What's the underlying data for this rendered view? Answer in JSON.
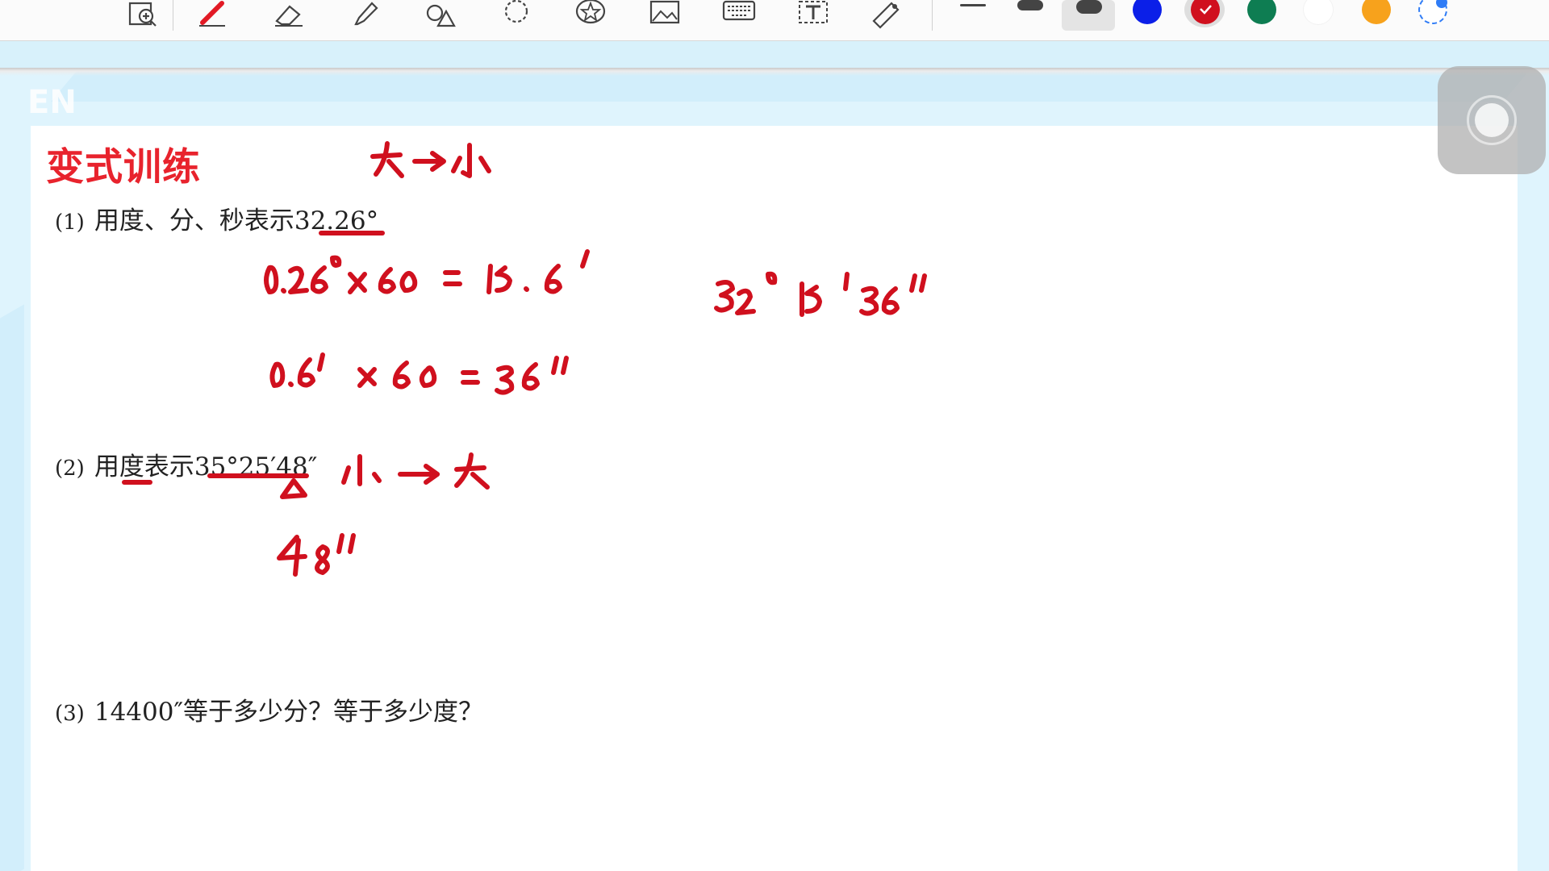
{
  "toolbar": {
    "tools": [
      "zoom-tool",
      "pen-tool",
      "eraser-tool",
      "highlighter-tool",
      "shapes-tool",
      "lasso-tool",
      "sticker-tool",
      "image-tool",
      "keyboard-tool",
      "text-tool",
      "laser-pointer-tool"
    ],
    "line_widths": [
      "thin",
      "medium",
      "thick"
    ],
    "colors": [
      {
        "name": "blue",
        "hex": "#0b1fe8"
      },
      {
        "name": "red",
        "hex": "#d0101e",
        "selected": true
      },
      {
        "name": "green",
        "hex": "#0e7d52"
      },
      {
        "name": "white",
        "hex": "#ffffff"
      },
      {
        "name": "orange",
        "hex": "#f7a21c"
      },
      {
        "name": "custom-color",
        "hex": "#2f7cf6"
      }
    ]
  },
  "watermark": "EN",
  "document": {
    "title": "变式训练",
    "questions": [
      {
        "number": "(1)",
        "text": "用度、分、秒表示32.26°"
      },
      {
        "number": "(2)",
        "text": "用度表示35°25′48″"
      },
      {
        "number": "(3)",
        "text": "14400″等于多少分？等于多少度？"
      }
    ]
  },
  "annotations": {
    "ink_color": "#d0101e",
    "big_to_small": "大→小",
    "line1": "0.26°×60=15.6′",
    "line2": "0.6′×60=36″",
    "result": "32°15′36″",
    "small_to_big": "小→大",
    "step_48": "48″"
  }
}
